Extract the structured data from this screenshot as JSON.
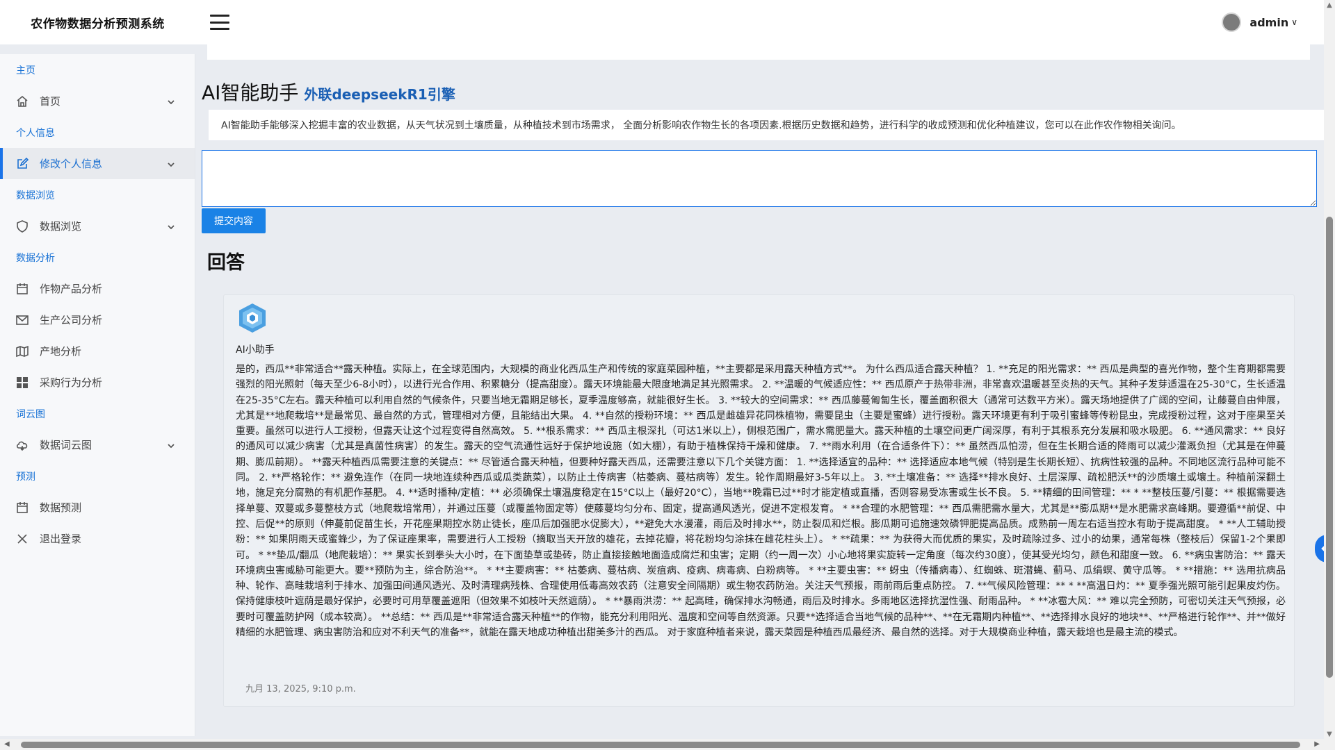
{
  "app": {
    "title": "农作物数据分析预测系统"
  },
  "header": {
    "username": "admin",
    "caret": "∨"
  },
  "sidebar": {
    "sections": [
      {
        "title": "主页"
      },
      {
        "title": "个人信息"
      },
      {
        "title": "数据浏览"
      },
      {
        "title": "数据分析"
      },
      {
        "title": "词云图"
      },
      {
        "title": "预测"
      }
    ],
    "items": [
      {
        "label": "首页",
        "icon": "home-icon"
      },
      {
        "label": "修改个人信息",
        "icon": "edit-icon",
        "active": true
      },
      {
        "label": "数据浏览",
        "icon": "shield-icon"
      },
      {
        "label": "作物产品分析",
        "icon": "calendar-icon"
      },
      {
        "label": "生产公司分析",
        "icon": "mail-icon"
      },
      {
        "label": "产地分析",
        "icon": "map-icon"
      },
      {
        "label": "采购行为分析",
        "icon": "grid-icon"
      },
      {
        "label": "数据词云图",
        "icon": "cloud-icon"
      },
      {
        "label": "数据预测",
        "icon": "calendar-icon"
      },
      {
        "label": "退出登录",
        "icon": "close-icon"
      }
    ]
  },
  "main": {
    "heading": "AI智能助手",
    "subheading": "外联deepseekR1引擎",
    "description": "AI智能助手能够深入挖掘丰富的农业数据，从天气状况到土壤质量，从种植技术到市场需求， 全面分析影响农作物生长的各项因素.根据历史数据和趋势，进行科学的收成预测和优化种植建议，您可以在此作农作物相关询问。",
    "input_value": "",
    "submit_label": "提交内容",
    "answer_title": "回答"
  },
  "answer": {
    "bot_name": "AI小助手",
    "text": "是的，西瓜**非常适合**露天种植。实际上，在全球范围内，大规模的商业化西瓜生产和传统的家庭菜园种植，**主要都是采用露天种植方式**。 为什么西瓜适合露天种植？ 1. **充足的阳光需求：** 西瓜是典型的喜光作物，整个生育期都需要强烈的阳光照射（每天至少6-8小时），以进行光合作用、积累糖分（提高甜度）。露天环境能最大限度地满足其光照需求。 2. **温暖的气候适应性：** 西瓜原产于热带非洲，非常喜欢温暖甚至炎热的天气。其种子发芽适温在25-30°C，生长适温在25-35°C左右。露天种植可以利用自然的气候条件，只要当地无霜期足够长，夏季温度够高，就能很好生长。 3. **较大的空间需求：** 西瓜藤蔓匍匐生长，覆盖面积很大（通常可达数平方米）。露天场地提供了广阔的空间，让藤蔓自由伸展，尤其是**地爬栽培**是最常见、最自然的方式，管理相对方便，且能结出大果。 4. **自然的授粉环境：** 西瓜是雌雄异花同株植物，需要昆虫（主要是蜜蜂）进行授粉。露天环境更有利于吸引蜜蜂等传粉昆虫，完成授粉过程，这对于座果至关重要。虽然可以进行人工授粉，但露天让这个过程变得自然高效。 5. **根系需求：** 西瓜主根深扎（可达1米以上），侧根范围广，需水需肥量大。露天种植的土壤空间更广阔深厚，有利于其根系充分发展和吸水吸肥。 6. **通风需求：** 良好的通风可以减少病害（尤其是真菌性病害）的发生。露天的空气流通性远好于保护地设施（如大棚），有助于植株保持干燥和健康。 7. **雨水利用（在合适条件下）：** 虽然西瓜怕涝，但在生长期合适的降雨可以减少灌溉负担（尤其是在伸蔓期、膨瓜前期）。 **露天种植西瓜需要注意的关键点：** 尽管适合露天种植，但要种好露天西瓜，还需要注意以下几个关键方面： 1. **选择适宜的品种：** 选择适应本地气候（特别是生长期长短）、抗病性较强的品种。不同地区流行品种可能不同。 2. **严格轮作：** 避免连作（在同一块地连续种西瓜或瓜类蔬菜），以防止土传病害（枯萎病、蔓枯病等）发生。轮作周期最好3-5年以上。 3. **土壤准备：** 选择**排水良好、土层深厚、疏松肥沃**的沙质壤土或壤土。种植前深翻土地，施足充分腐熟的有机肥作基肥。 4. **适时播种/定植：** 必须确保土壤温度稳定在15°C以上（最好20°C），当地**晚霜已过**时才能定植或直播，否则容易受冻害或生长不良。 5. **精细的田间管理：** * **整枝压蔓/引蔓：** 根据需要选择单蔓、双蔓或多蔓整枝方式（地爬栽培常用），并通过压蔓（或覆盖物固定等）使藤蔓均匀分布、固定，提高通风透光，促进不定根发育。 * **合理的水肥管理：** 西瓜需肥需水量大，尤其是**膨瓜期**是水肥需求高峰期。要遵循**前促、中控、后促**的原则（伸蔓前促苗生长，开花座果期控水防止徒长，座瓜后加强肥水促膨大），**避免大水漫灌，雨后及时排水**，防止裂瓜和烂根。膨瓜期可追施速效磷钾肥提高品质。成熟前一周左右适当控水有助于提高甜度。 * **人工辅助授粉：** 如果阴雨天或蜜蜂少，为了保证座果率，需要进行人工授粉（摘取当天开放的雄花，去掉花瓣，将花粉均匀涂抹在雌花柱头上）。 * **疏果：** 为获得大而优质的果实，及时疏除过多、过小的幼果，通常每株（整枝后）保留1-2个果即可。 * **垫瓜/翻瓜（地爬栽培）：** 果实长到拳头大小时，在下面垫草或垫砖，防止直接接触地面造成腐烂和虫害；定期（约一周一次）小心地将果实旋转一定角度（每次约30度），使其受光均匀，颜色和甜度一致。 6. **病虫害防治：** 露天环境病虫害威胁可能更大。要**预防为主，综合防治**。 * **主要病害：** 枯萎病、蔓枯病、炭疽病、疫病、病毒病、白粉病等。 * **主要虫害：** 蚜虫（传播病毒）、红蜘蛛、斑潜蝇、蓟马、瓜绢螟、黄守瓜等。 * **措施：** 选用抗病品种、轮作、高畦栽培利于排水、加强田间通风透光、及时清理病残株、合理使用低毒高效农药（注意安全间隔期）或生物农药防治。关注天气预报，雨前雨后重点防控。 7. **气候风险管理：** * **高温日灼：** 夏季强光照可能引起果皮灼伤。保持健康枝叶遮荫是最好保护，必要时可用草覆盖遮阳（但效果不如枝叶天然遮荫）。 * **暴雨洪涝：** 起高畦，确保排水沟畅通，雨后及时排水。多雨地区选择抗湿性强、耐雨品种。 * **冰雹大风：** 难以完全预防，可密切关注天气预报，必要时可覆盖防护网（成本较高）。 **总结：** 西瓜是**非常适合露天种植**的作物，能充分利用阳光、温度和空间等自然资源。只要**选择适合当地气候的品种**、**在无霜期内种植**、**选择排水良好的地块**、**严格进行轮作**、并**做好精细的水肥管理、病虫害防治和应对不利天气的准备**，就能在露天地成功种植出甜美多汁的西瓜。 对于家庭种植者来说，露天菜园是种植西瓜最经济、最自然的选择。对于大规模商业种植，露天栽培也是最主流的模式。",
    "timestamp": "九月 13, 2025, 9:10 p.m."
  },
  "colors": {
    "accent": "#1a73e8",
    "sidebar_section": "#1a73d6",
    "background": "#e9ecf1"
  }
}
